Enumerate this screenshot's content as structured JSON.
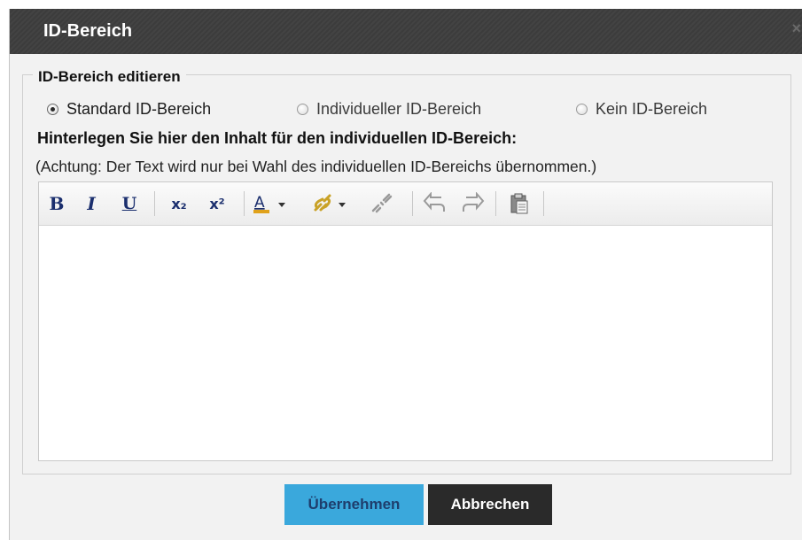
{
  "dialog": {
    "title": "ID-Bereich",
    "close_icon": "close-icon"
  },
  "group": {
    "legend": "ID-Bereich editieren",
    "options": [
      {
        "label": "Standard ID-Bereich",
        "selected": true
      },
      {
        "label": "Individueller ID-Bereich",
        "selected": false
      },
      {
        "label": "Kein ID-Bereich",
        "selected": false
      }
    ],
    "heading": "Hinterlegen Sie hier den Inhalt für den individuellen ID-Bereich:",
    "note": "(Achtung: Der Text wird nur bei Wahl des individuellen ID-Bereichs übernommen.)"
  },
  "toolbar": {
    "bold": "B",
    "italic": "I",
    "underline": "U",
    "subscript": "x₂",
    "superscript": "x²",
    "icons": [
      "bold-icon",
      "italic-icon",
      "underline-icon",
      "subscript-icon",
      "superscript-icon",
      "text-color-icon",
      "link-icon",
      "unlink-icon",
      "undo-icon",
      "redo-icon",
      "paste-icon"
    ]
  },
  "editor": {
    "content": ""
  },
  "buttons": {
    "apply": "Übernehmen",
    "cancel": "Abbrechen"
  },
  "colors": {
    "titlebar": "#3c3c3c",
    "apply": "#3aa8dc",
    "cancel": "#2a2a2a",
    "dialog_bg": "#f2f2f2"
  }
}
